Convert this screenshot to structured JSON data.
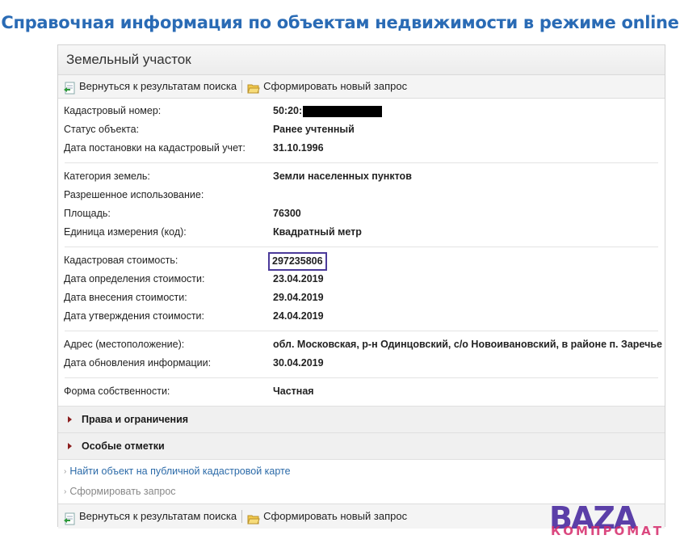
{
  "page": {
    "header": "Справочная информация по объектам недвижимости в режиме online"
  },
  "panel": {
    "title": "Земельный участок"
  },
  "toolbar": {
    "back_label": "Вернуться к результатам поиска",
    "new_request_label": "Сформировать новый запрос"
  },
  "sections": {
    "basic": [
      {
        "label": "Кадастровый номер:",
        "value": "50:20:"
      },
      {
        "label": "Статус объекта:",
        "value": "Ранее учтенный"
      },
      {
        "label": "Дата постановки на кадастровый учет:",
        "value": "31.10.1996"
      }
    ],
    "land": [
      {
        "label": "Категория земель:",
        "value": "Земли населенных пунктов"
      },
      {
        "label": "Разрешенное использование:",
        "value": ""
      },
      {
        "label": "Площадь:",
        "value": "76300"
      },
      {
        "label": "Единица измерения (код):",
        "value": "Квадратный метр"
      }
    ],
    "cost": [
      {
        "label": "Кадастровая стоимость:",
        "value": "297235806"
      },
      {
        "label": "Дата определения стоимости:",
        "value": "23.04.2019"
      },
      {
        "label": "Дата внесения стоимости:",
        "value": "29.04.2019"
      },
      {
        "label": "Дата утверждения стоимости:",
        "value": "24.04.2019"
      }
    ],
    "address": [
      {
        "label": "Адрес (местоположение):",
        "value": "обл. Московская, р-н Одинцовский, с/о Новоивановский, в районе п. Заречье"
      },
      {
        "label": "Дата обновления информации:",
        "value": "30.04.2019"
      }
    ],
    "ownership": [
      {
        "label": "Форма собственности:",
        "value": "Частная"
      }
    ]
  },
  "collapsibles": {
    "rights": "Права и ограничения",
    "notes": "Особые отметки"
  },
  "links": {
    "map_link": "Найти объект на публичной кадастровой карте",
    "request_link": "Сформировать запрос"
  },
  "watermark": {
    "main": "BAZA",
    "sub": "КОМПРОМАТ"
  },
  "colors": {
    "header_blue": "#2a6bb5",
    "link_blue": "#2b6aa8",
    "highlight_box": "#4b3a9a",
    "triangle": "#8b1d1d",
    "watermark_purple": "#5b3fa8",
    "watermark_pink": "#d52a6a"
  }
}
